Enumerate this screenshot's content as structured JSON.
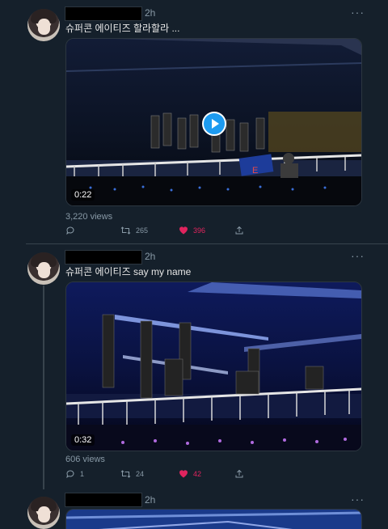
{
  "tweets": [
    {
      "time": "2h",
      "more": "···",
      "text": "슈퍼콘 에이티즈 할라할라 ...",
      "duration": "0:22",
      "views": "3,220 views",
      "retweets": "265",
      "likes": "396"
    },
    {
      "time": "2h",
      "more": "···",
      "text": "슈퍼콘 에이티즈 say my name",
      "duration": "0:32",
      "views": "606 views",
      "replies": "1",
      "retweets": "24",
      "likes": "42"
    },
    {
      "time": "2h",
      "more": "···"
    }
  ],
  "icons": {
    "reply": "reply-icon",
    "retweet": "retweet-icon",
    "like": "heart-icon",
    "share": "share-icon",
    "play": "play-icon",
    "more": "more-icon"
  },
  "colors": {
    "background": "#15202b",
    "like_active": "#e0245e",
    "play_button": "#1d9bf0",
    "muted_text": "#8899a6"
  }
}
